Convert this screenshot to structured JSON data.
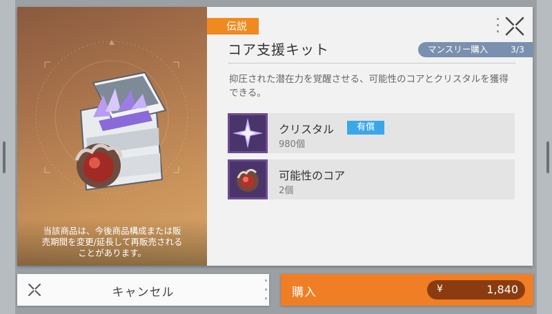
{
  "product": {
    "rarity": "伝説",
    "title": "コア支援キット",
    "limit_label": "マンスリー購入",
    "limit_count": "3/3",
    "description": "抑圧された潜在力を覚醒させる、可能性のコアとクリスタルを獲得できる。",
    "notice": "当該商品は、今後商品構成または販\n売期間を変更/延長して再販売される\nことがあります。"
  },
  "items": [
    {
      "name": "クリスタル",
      "badge": "有償",
      "quantity": "980個",
      "icon": "crystal-icon"
    },
    {
      "name": "可能性のコア",
      "quantity": "2個",
      "icon": "core-icon"
    }
  ],
  "actions": {
    "cancel_label": "キャンセル",
    "buy_label": "購入",
    "currency": "¥",
    "price": "1,840"
  },
  "colors": {
    "rarity": "#f08a1e",
    "limit_badge": "#7b8fae",
    "paid_badge": "#3aa7ea",
    "buy_button": "#f07e24",
    "price_pill": "#8a3c10"
  }
}
